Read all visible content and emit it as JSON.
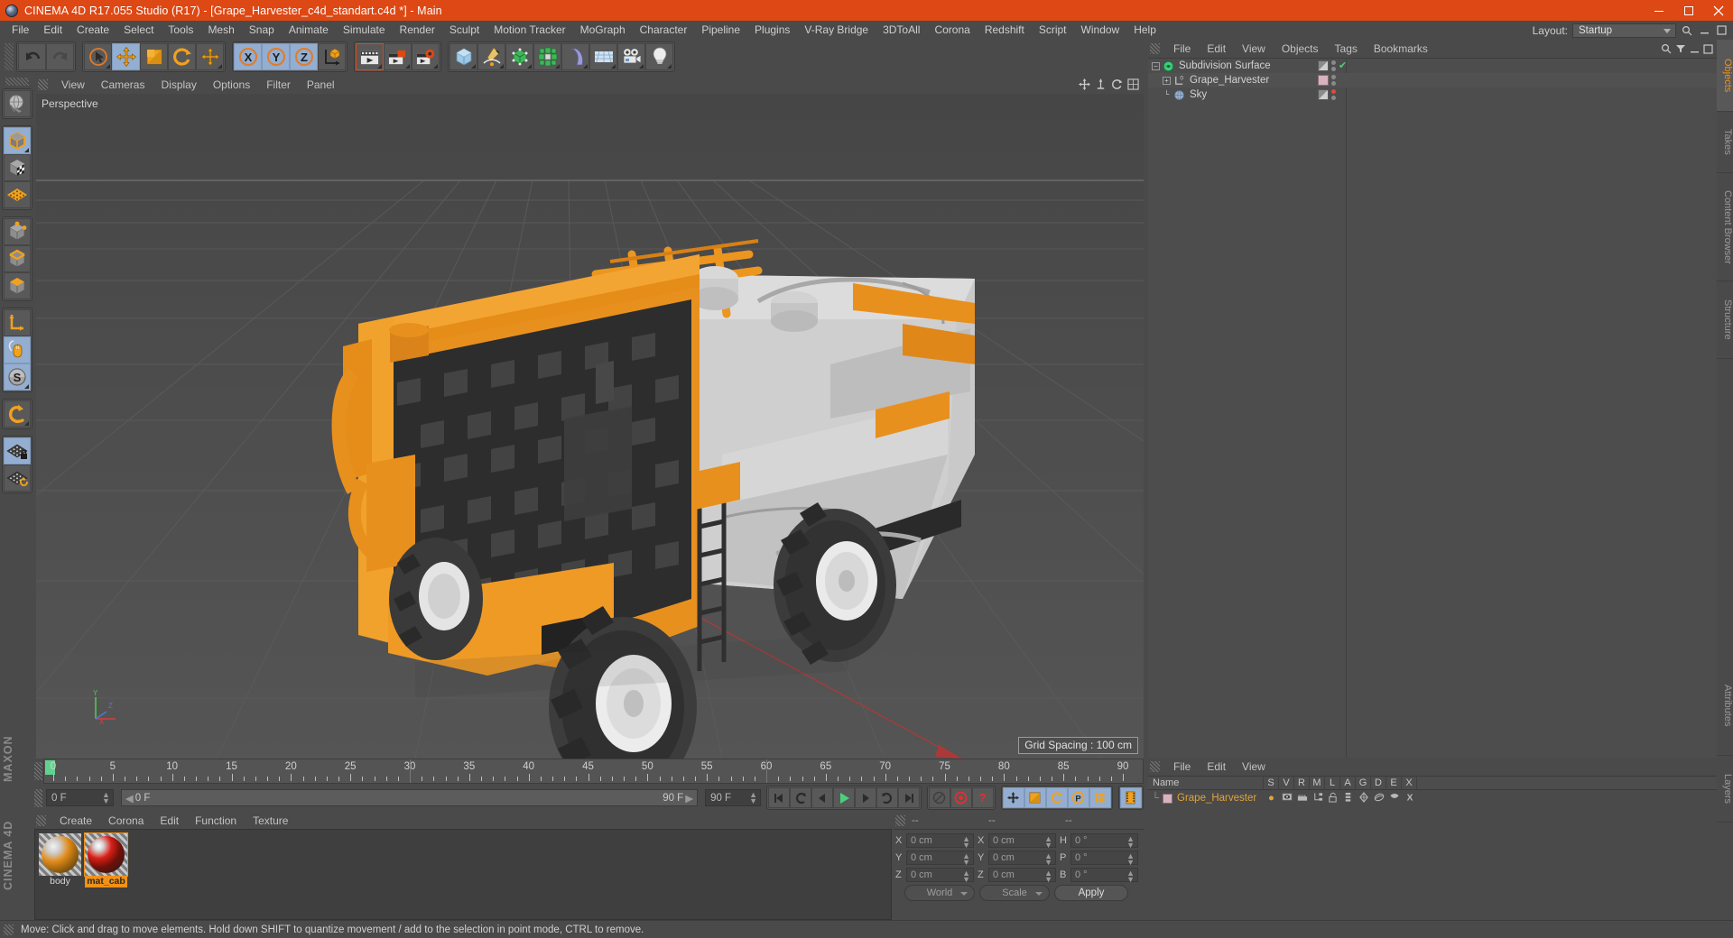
{
  "window": {
    "title": "CINEMA 4D R17.055 Studio (R17) - [Grape_Harvester_c4d_standart.c4d *] - Main",
    "app_icon": "cinema4d-logo-icon",
    "minimize": "minimize-icon",
    "maximize": "maximize-icon",
    "close": "close-icon"
  },
  "menubar": {
    "items": [
      "File",
      "Edit",
      "Create",
      "Select",
      "Tools",
      "Mesh",
      "Snap",
      "Animate",
      "Simulate",
      "Render",
      "Sculpt",
      "Motion Tracker",
      "MoGraph",
      "Character",
      "Pipeline",
      "Plugins",
      "V-Ray Bridge",
      "3DToAll",
      "Corona",
      "Redshift",
      "Script",
      "Window",
      "Help"
    ],
    "layout_label": "Layout:",
    "layout_value": "Startup"
  },
  "toolbar": {
    "groups": [
      {
        "buttons": [
          {
            "name": "undo-button",
            "icon": "undo-arrow-icon",
            "selected": false
          },
          {
            "name": "redo-button",
            "icon": "redo-arrow-icon",
            "selected": false
          }
        ]
      },
      {
        "buttons": [
          {
            "name": "live-selection-tool",
            "icon": "cursor-circle-icon",
            "selected": false
          },
          {
            "name": "move-tool",
            "icon": "move-arrows-icon",
            "selected": true
          },
          {
            "name": "scale-tool",
            "icon": "scale-box-icon",
            "selected": false
          },
          {
            "name": "rotate-tool",
            "icon": "rotate-circle-icon",
            "selected": false
          },
          {
            "name": "last-used-tool",
            "icon": "move-arrows-icon",
            "selected": false
          }
        ]
      },
      {
        "buttons": [
          {
            "name": "axis-x-lock",
            "icon": "x-axis-icon",
            "label": "X",
            "selected": true
          },
          {
            "name": "axis-y-lock",
            "icon": "y-axis-icon",
            "label": "Y",
            "selected": true
          },
          {
            "name": "axis-z-lock",
            "icon": "z-axis-icon",
            "label": "Z",
            "selected": true
          },
          {
            "name": "world-object-coordinate-toggle",
            "icon": "world-axis-cube-icon",
            "selected": false
          }
        ]
      },
      {
        "buttons": [
          {
            "name": "render-view-button",
            "icon": "clapboard-render-icon",
            "selected": false
          },
          {
            "name": "render-to-picture-viewer-button",
            "icon": "clapboard-picture-icon",
            "selected": false
          },
          {
            "name": "edit-render-settings-button",
            "icon": "clapboard-gear-icon",
            "selected": false
          }
        ]
      },
      {
        "buttons": [
          {
            "name": "add-cube-object",
            "icon": "cube-primitive-icon",
            "selected": false
          },
          {
            "name": "add-spline",
            "icon": "pen-spline-icon",
            "selected": false
          },
          {
            "name": "add-nurbs-generator",
            "icon": "green-nurbs-cube-icon",
            "selected": false
          },
          {
            "name": "add-array-modeling-object",
            "icon": "mograph-cluster-icon",
            "selected": false
          },
          {
            "name": "add-deformer",
            "icon": "bend-deformer-icon",
            "selected": false
          },
          {
            "name": "add-scene-environment",
            "icon": "floor-grid-icon",
            "selected": false
          },
          {
            "name": "add-camera",
            "icon": "camera-icon",
            "selected": false
          },
          {
            "name": "add-light",
            "icon": "light-bulb-icon",
            "selected": false
          }
        ]
      }
    ]
  },
  "left_toolbar": {
    "groups": [
      {
        "buttons": [
          {
            "name": "make-editable-button",
            "icon": "globe-editable-icon",
            "selected": false
          }
        ]
      },
      {
        "buttons": [
          {
            "name": "model-mode-button",
            "icon": "model-cube-icon",
            "selected": true
          },
          {
            "name": "texture-mode-button",
            "icon": "texture-checker-cube-icon",
            "selected": false
          },
          {
            "name": "workplane-mode-button",
            "icon": "workplane-grid-icon",
            "selected": false
          }
        ]
      },
      {
        "buttons": [
          {
            "name": "points-mode-button",
            "icon": "point-cube-icon",
            "selected": false
          },
          {
            "name": "edges-mode-button",
            "icon": "edge-cube-icon",
            "selected": false
          },
          {
            "name": "polygons-mode-button",
            "icon": "polygon-cube-icon",
            "selected": false
          }
        ]
      },
      {
        "buttons": [
          {
            "name": "object-axis-mode-button",
            "icon": "axis-l-arrow-icon",
            "selected": false
          },
          {
            "name": "enable-axis-modification-button",
            "icon": "mouse-axis-icon",
            "selected": true
          },
          {
            "name": "soft-selection-button",
            "icon": "s-sphere-icon",
            "selected": true
          }
        ]
      },
      {
        "buttons": [
          {
            "name": "magnet-tool-button",
            "icon": "magnet-icon",
            "selected": false
          }
        ]
      },
      {
        "buttons": [
          {
            "name": "lock-workplane-button",
            "icon": "grid-lock-icon",
            "selected": true
          },
          {
            "name": "planar-workplane-button",
            "icon": "grid-rotate-icon",
            "selected": false
          }
        ]
      }
    ],
    "brand_top": "MAXON",
    "brand_bottom": "CINEMA 4D"
  },
  "viewport": {
    "menu": [
      "View",
      "Cameras",
      "Display",
      "Options",
      "Filter",
      "Panel"
    ],
    "label": "Perspective",
    "grid_spacing": "Grid Spacing : 100 cm",
    "axis_labels": {
      "x": "X",
      "y": "Y",
      "z": "Z"
    },
    "corner_icons": [
      "viewport-move-icon",
      "viewport-scale-icon",
      "viewport-rotate-icon",
      "viewport-maximize-icon"
    ],
    "scene_description": "Orange and grey grape harvester 3D model on a grey perspective grid"
  },
  "timeline": {
    "ticks": [
      0,
      5,
      10,
      15,
      20,
      25,
      30,
      35,
      40,
      45,
      50,
      55,
      60,
      65,
      70,
      75,
      80,
      85,
      90
    ],
    "current_frame": "0 F",
    "range_start": "0 F",
    "range_end": "90 F",
    "end_frame_field": "90 F",
    "preview_frame_field": "0 F",
    "playhead_frame": 0,
    "controls": [
      {
        "name": "go-to-start-button",
        "icon": "skip-start-icon",
        "selected": false
      },
      {
        "name": "go-to-previous-key-button",
        "icon": "prev-key-icon",
        "selected": false
      },
      {
        "name": "go-to-previous-frame-button",
        "icon": "step-back-icon",
        "selected": false
      },
      {
        "name": "play-button",
        "icon": "play-icon",
        "selected": false
      },
      {
        "name": "go-to-next-frame-button",
        "icon": "step-forward-icon",
        "selected": false
      },
      {
        "name": "go-to-next-key-button",
        "icon": "next-key-icon",
        "selected": false
      },
      {
        "name": "go-to-end-button",
        "icon": "skip-end-icon",
        "selected": false
      },
      {
        "name": "play-sound-toggle",
        "icon": "sound-off-icon",
        "selected": false
      },
      {
        "name": "record-active-objects-button",
        "icon": "record-red-icon",
        "selected": false
      },
      {
        "name": "autokeying-button",
        "icon": "autokey-red-icon",
        "selected": false
      },
      {
        "name": "key-position-toggle",
        "icon": "key-position-icon",
        "selected": true
      },
      {
        "name": "key-scale-toggle",
        "icon": "key-scale-icon",
        "selected": true
      },
      {
        "name": "key-rotation-toggle",
        "icon": "key-rotation-icon",
        "selected": true
      },
      {
        "name": "key-parameter-toggle",
        "icon": "key-param-icon",
        "selected": true
      },
      {
        "name": "key-pointlevel-toggle",
        "icon": "key-points-icon",
        "selected": true
      },
      {
        "name": "timeline-mode-button",
        "icon": "film-strip-icon",
        "selected": true
      }
    ]
  },
  "material_manager": {
    "menu": [
      "Create",
      "Corona",
      "Edit",
      "Function",
      "Texture"
    ],
    "materials": [
      {
        "name": "body",
        "selected": false,
        "swatch_colors": [
          "#e08a18",
          "#3a3a3a",
          "#d8d8d8"
        ]
      },
      {
        "name": "mat_cab",
        "selected": true,
        "swatch_colors": [
          "#d81f16",
          "#222222",
          "#e08a18"
        ]
      }
    ]
  },
  "coordinates": {
    "headers": [
      "--",
      "--",
      "--"
    ],
    "rows": [
      {
        "pos_label": "X",
        "pos_value": "0 cm",
        "size_label": "X",
        "size_value": "0 cm",
        "rot_label": "H",
        "rot_value": "0 °"
      },
      {
        "pos_label": "Y",
        "pos_value": "0 cm",
        "size_label": "Y",
        "size_value": "0 cm",
        "rot_label": "P",
        "rot_value": "0 °"
      },
      {
        "pos_label": "Z",
        "pos_value": "0 cm",
        "size_label": "Z",
        "size_value": "0 cm",
        "rot_label": "B",
        "rot_value": "0 °"
      }
    ],
    "system": "World",
    "mode": "Scale",
    "apply": "Apply"
  },
  "object_manager": {
    "menu": [
      "File",
      "Edit",
      "View",
      "Objects",
      "Tags",
      "Bookmarks"
    ],
    "tools": [
      "search-icon",
      "filter-icon",
      "minimize-panel-icon",
      "maximize-panel-icon"
    ],
    "objects": [
      {
        "name": "Subdivision Surface",
        "icon": "subdivision-surface-icon",
        "indent": 0,
        "expander": "-",
        "tag_icon": "checker-tag-icon",
        "dot": true,
        "state": "green-check"
      },
      {
        "name": "Grape_Harvester",
        "icon": "null-object-icon",
        "indent": 1,
        "expander": "+",
        "tag_icon": "material-tag-icon",
        "dot": true,
        "state": "none"
      },
      {
        "name": "Sky",
        "icon": "sky-object-icon",
        "indent": 1,
        "expander": "",
        "tag_icon": "checker-tag-icon",
        "dot": true,
        "state": "red-dot"
      }
    ]
  },
  "right_tabs": [
    {
      "label": "Objects",
      "active": true
    },
    {
      "label": "Takes",
      "active": false
    },
    {
      "label": "Content Browser",
      "active": false
    },
    {
      "label": "Structure",
      "active": false
    }
  ],
  "right_edge_tabs": [
    {
      "label": "Attributes",
      "active": false
    },
    {
      "label": "Layers",
      "active": false
    }
  ],
  "attribute_manager": {
    "menu": [
      "File",
      "Edit",
      "View"
    ],
    "columns": [
      "Name",
      "S",
      "V",
      "R",
      "M",
      "L",
      "A",
      "G",
      "D",
      "E",
      "X"
    ],
    "rows": [
      {
        "name": "Grape_Harvester",
        "icons": [
          "dot-icon",
          "visibility-icon",
          "render-icon",
          "hierarchy-icon",
          "unlock-icon",
          "animation-icon",
          "generator-icon",
          "deformer-icon",
          "expression-icon",
          "xpresso-icon"
        ]
      }
    ]
  },
  "statusbar": {
    "text": "Move: Click and drag to move elements. Hold down SHIFT to quantize movement / add to the selection in point mode, CTRL to remove."
  },
  "colors": {
    "accent_orange": "#dd4814",
    "selection_blue": "#93aed0",
    "panel_bg": "#4a4a4a",
    "highlight_orange": "#f19116"
  }
}
